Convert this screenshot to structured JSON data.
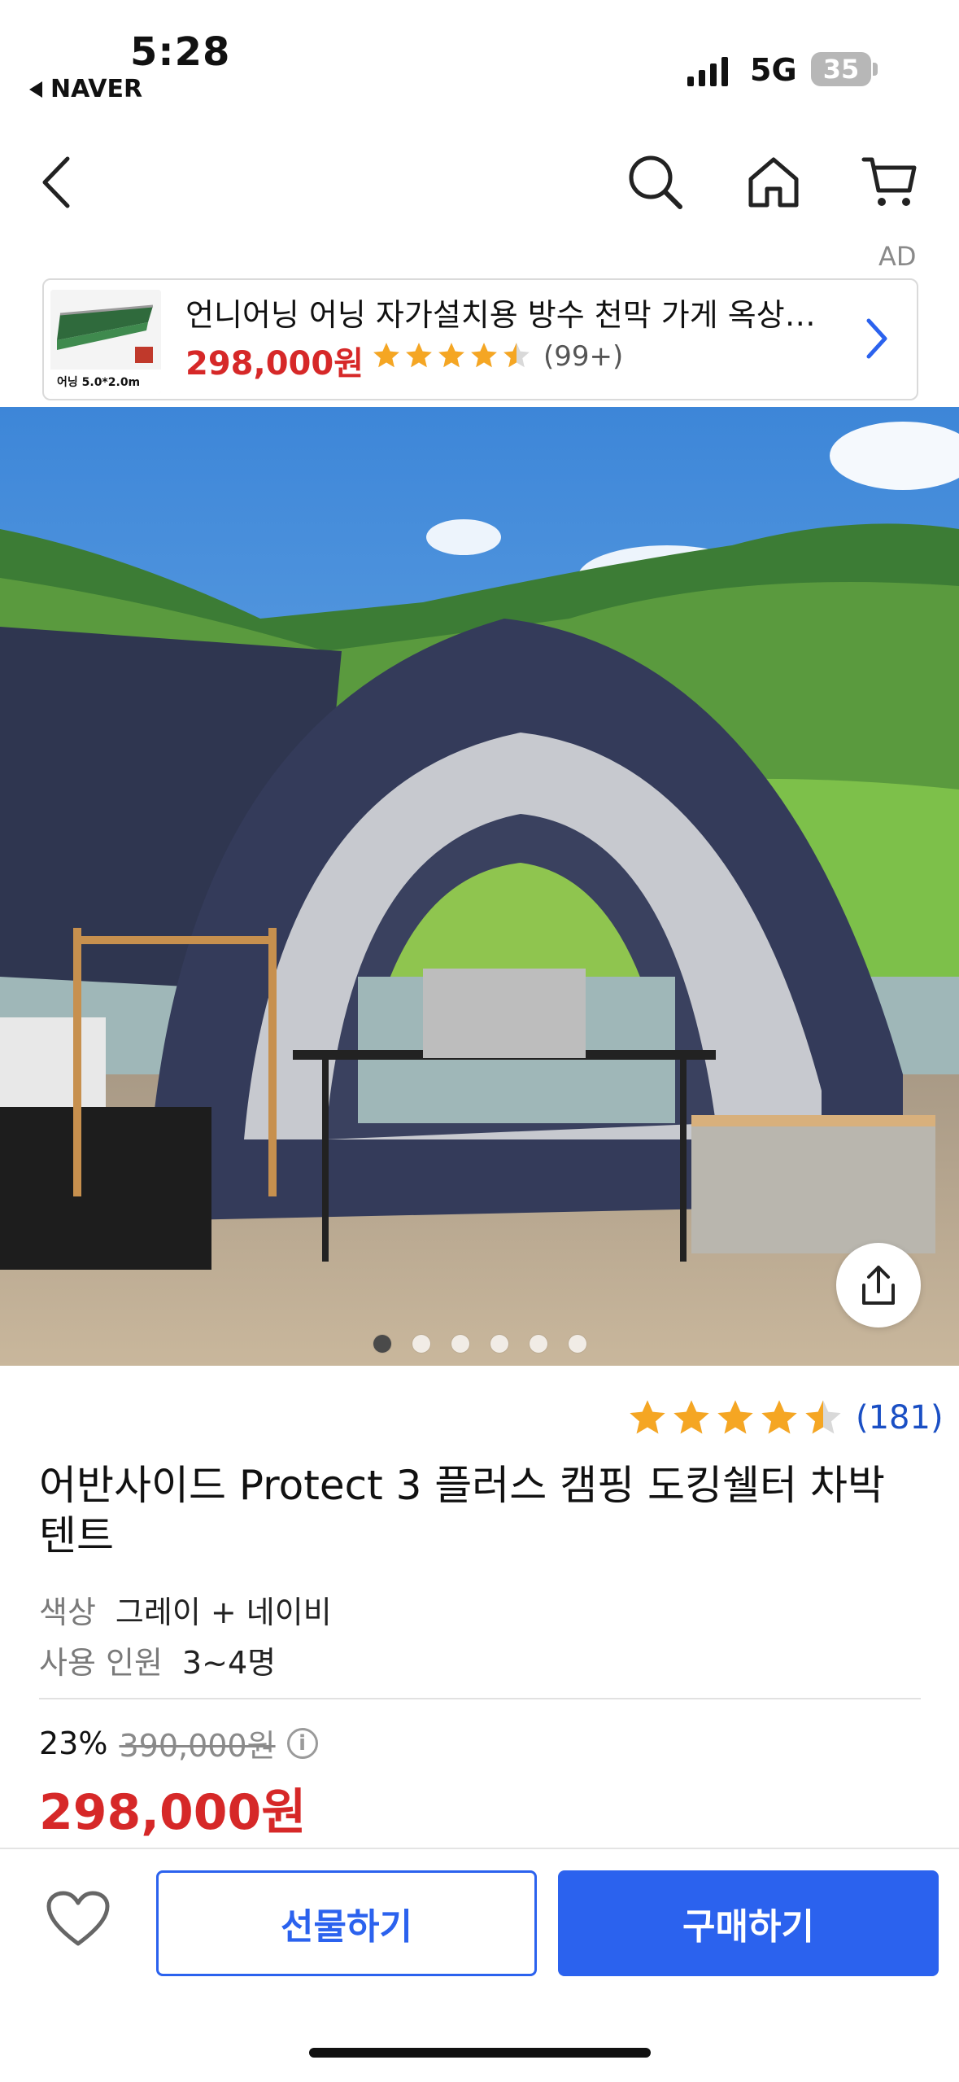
{
  "status_bar": {
    "time": "5:28",
    "back_app": "NAVER",
    "network": "5G",
    "battery": "35"
  },
  "nav": {
    "back_icon": "chevron-left-icon",
    "search_icon": "search-icon",
    "home_icon": "home-icon",
    "cart_icon": "cart-icon"
  },
  "ad": {
    "label": "AD",
    "title": "언니어닝 어닝 자가설치용 방수 천막 가게 옥상…",
    "price": "298,000원",
    "rating": 4.5,
    "review_count": "(99+)",
    "thumb_caption": "어닝 5.0*2.0m"
  },
  "gallery": {
    "total": 6,
    "active_index": 0
  },
  "product": {
    "rating": 4.5,
    "review_count": "(181)",
    "title": "어반사이드 Protect 3 플러스 캠핑 도킹쉘터 차박 텐트",
    "options": [
      {
        "key": "색상",
        "value": "그레이 + 네이비"
      },
      {
        "key": "사용 인원",
        "value": "3~4명"
      }
    ],
    "discount_rate": "23%",
    "original_price": "390,000원",
    "price": "298,000원"
  },
  "actions": {
    "gift_label": "선물하기",
    "buy_label": "구매하기"
  },
  "colors": {
    "accent": "#2b62ee",
    "price_red": "#d62828",
    "star": "#f5a623"
  }
}
